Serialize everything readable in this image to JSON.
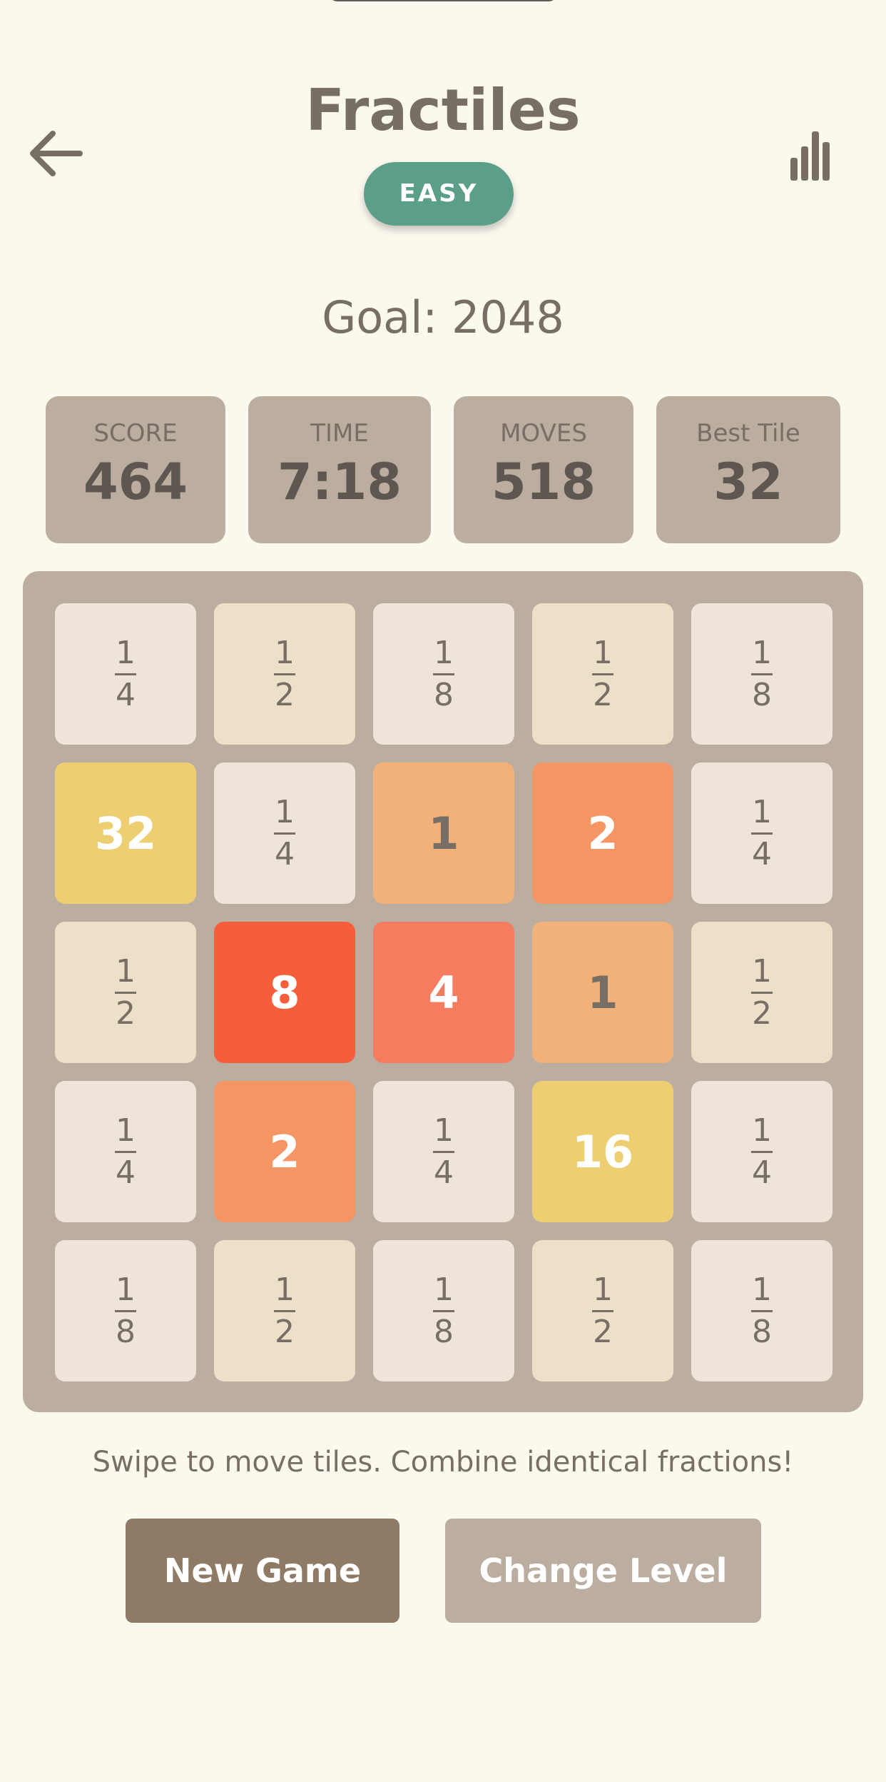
{
  "header": {
    "title": "Fractiles",
    "difficulty": "EASY",
    "back_icon": "arrow-left-icon",
    "stats_icon": "bar-chart-icon"
  },
  "goal": "Goal: 2048",
  "stats": {
    "score": {
      "label": "SCORE",
      "value": "464"
    },
    "time": {
      "label": "TIME",
      "value": "7:18"
    },
    "moves": {
      "label": "MOVES",
      "value": "518"
    },
    "best": {
      "label": "Best Tile",
      "value": "32"
    }
  },
  "board": {
    "rows": [
      [
        {
          "type": "frac",
          "num": "1",
          "den": "4"
        },
        {
          "type": "frac",
          "num": "1",
          "den": "2"
        },
        {
          "type": "frac",
          "num": "1",
          "den": "8"
        },
        {
          "type": "frac",
          "num": "1",
          "den": "2"
        },
        {
          "type": "frac",
          "num": "1",
          "den": "8"
        }
      ],
      [
        {
          "type": "int",
          "value": "32"
        },
        {
          "type": "frac",
          "num": "1",
          "den": "4"
        },
        {
          "type": "int",
          "value": "1"
        },
        {
          "type": "int",
          "value": "2"
        },
        {
          "type": "frac",
          "num": "1",
          "den": "4"
        }
      ],
      [
        {
          "type": "frac",
          "num": "1",
          "den": "2"
        },
        {
          "type": "int",
          "value": "8"
        },
        {
          "type": "int",
          "value": "4"
        },
        {
          "type": "int",
          "value": "1"
        },
        {
          "type": "frac",
          "num": "1",
          "den": "2"
        }
      ],
      [
        {
          "type": "frac",
          "num": "1",
          "den": "4"
        },
        {
          "type": "int",
          "value": "2"
        },
        {
          "type": "frac",
          "num": "1",
          "den": "4"
        },
        {
          "type": "int",
          "value": "16"
        },
        {
          "type": "frac",
          "num": "1",
          "den": "4"
        }
      ],
      [
        {
          "type": "frac",
          "num": "1",
          "den": "8"
        },
        {
          "type": "frac",
          "num": "1",
          "den": "2"
        },
        {
          "type": "frac",
          "num": "1",
          "den": "8"
        },
        {
          "type": "frac",
          "num": "1",
          "den": "2"
        },
        {
          "type": "frac",
          "num": "1",
          "den": "8"
        }
      ]
    ],
    "colors": {
      "1/8": {
        "bg": "#eee4da",
        "fg": "#776e65"
      },
      "1/4": {
        "bg": "#eee4da",
        "fg": "#776e65"
      },
      "1/2": {
        "bg": "#ede0c8",
        "fg": "#776e65"
      },
      "1": {
        "bg": "#f2b179",
        "fg": "#776e65"
      },
      "2": {
        "bg": "#f59563",
        "fg": "#ffffff"
      },
      "4": {
        "bg": "#f67c5f",
        "fg": "#ffffff"
      },
      "8": {
        "bg": "#f65e3b",
        "fg": "#ffffff"
      },
      "16": {
        "bg": "#edcf72",
        "fg": "#ffffff"
      },
      "32": {
        "bg": "#edcf72",
        "fg": "#ffffff"
      }
    }
  },
  "instructions": "Swipe to move tiles. Combine identical fractions!",
  "buttons": {
    "new_game": "New Game",
    "change_level": "Change Level"
  },
  "colors": {
    "background": "#fbf8ee",
    "board": "#bbada0",
    "accent": "#5b9e8a",
    "primary_button": "#8f7a66",
    "secondary_button": "#bbada0",
    "text": "#776e65"
  }
}
